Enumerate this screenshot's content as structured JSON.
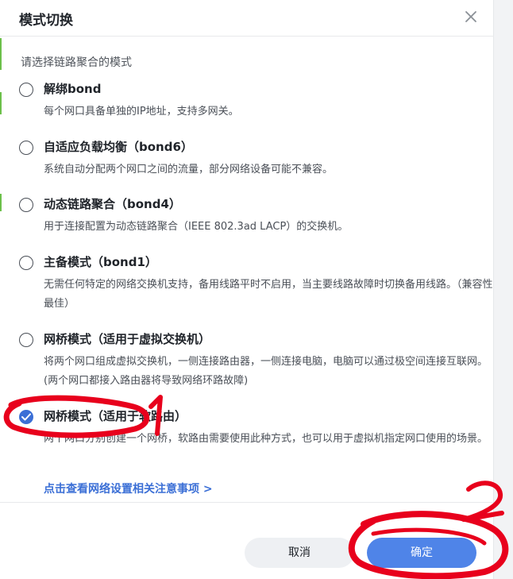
{
  "dialog": {
    "title": "模式切换",
    "prompt": "请选择链路聚合的模式",
    "options": [
      {
        "title": "解绑bond",
        "desc": "每个网口具备单独的IP地址，支持多网关。",
        "selected": false
      },
      {
        "title": "自适应负载均衡（bond6）",
        "desc": "系统自动分配两个网口之间的流量，部分网络设备可能不兼容。",
        "selected": false
      },
      {
        "title": "动态链路聚合（bond4）",
        "desc": "用于连接配置为动态链路聚合（IEEE 802.3ad LACP）的交换机。",
        "selected": false
      },
      {
        "title": "主备模式（bond1）",
        "desc": "无需任何特定的网络交换机支持，备用线路平时不启用，当主要线路故障时切换备用线路。（兼容性最佳）",
        "selected": false
      },
      {
        "title": "网桥模式（适用于虚拟交换机）",
        "desc": "将两个网口组成虚拟交换机，一侧连接路由器，一侧连接电脑，电脑可以通过极空间连接互联网。(两个网口都接入路由器将导致网络环路故障)",
        "selected": false
      },
      {
        "title": "网桥模式（适用于软路由）",
        "desc": "两个网口分别创建一个网桥，软路由需要使用此种方式，也可以用于虚拟机指定网口使用的场景。",
        "selected": true
      }
    ],
    "link": "点击查看网络设置相关注意事项 >",
    "cancel_label": "取消",
    "confirm_label": "确定"
  },
  "annotations": {
    "mark_1": "1",
    "mark_2": "2"
  },
  "colors": {
    "accent": "#3b6fd6",
    "button_primary": "#4f84e8",
    "annotation": "#e8001c"
  },
  "icons": {
    "close": "close-icon",
    "check": "check-icon",
    "link_arrow": "chevron-right-icon"
  }
}
